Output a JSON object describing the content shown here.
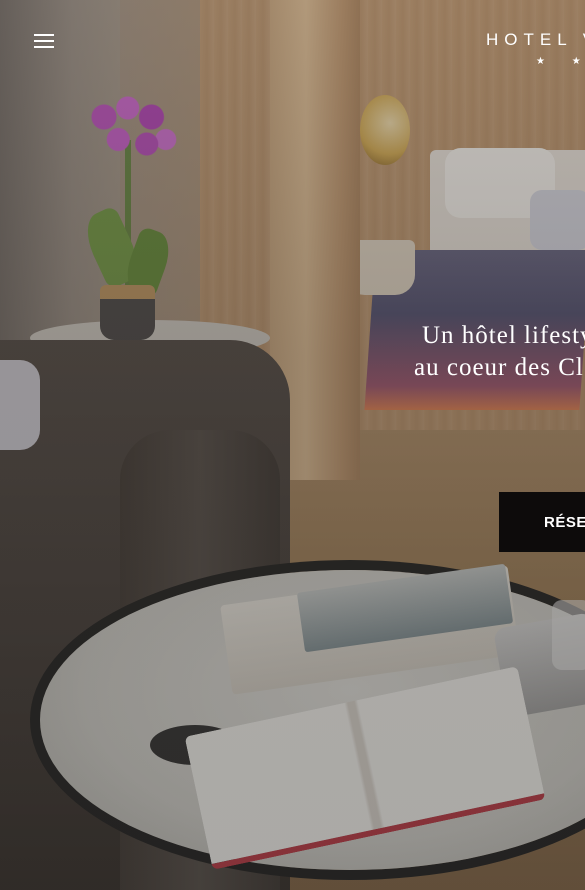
{
  "header": {
    "menu_icon": "hamburger-menu-icon",
    "logo_text": "HOTEL V",
    "logo_stars": "★ ★ ★"
  },
  "hero": {
    "tagline_line1": "Un hôtel lifesty",
    "tagline_line2": "au coeur des Cl",
    "reserve_label": "RÉSER"
  },
  "colors": {
    "text": "#ffffff",
    "button_bg": "#0d0b0b"
  }
}
